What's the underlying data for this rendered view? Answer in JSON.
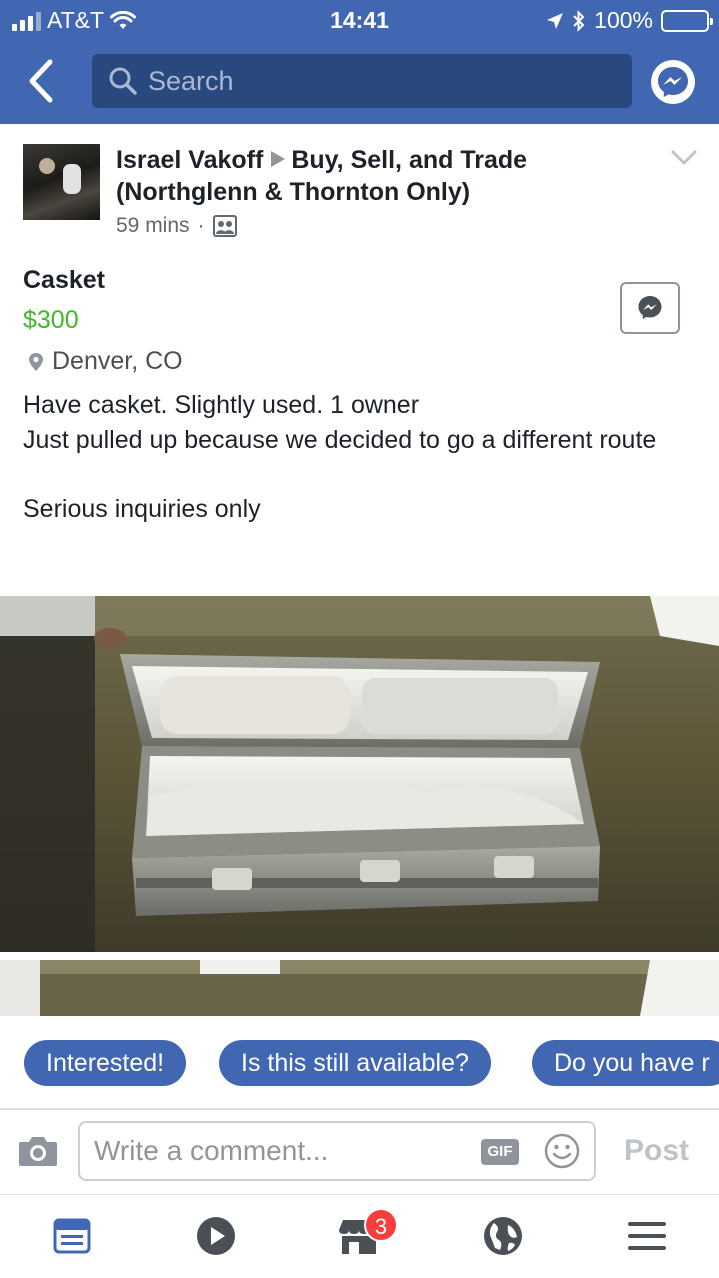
{
  "status_bar": {
    "carrier": "AT&T",
    "time": "14:41",
    "battery": "100%",
    "icons": [
      "signal-icon",
      "wifi-icon",
      "location-arrow-icon",
      "bluetooth-icon",
      "battery-icon"
    ]
  },
  "nav": {
    "search_placeholder": "Search",
    "icons": [
      "back-chevron-icon",
      "search-icon",
      "messenger-icon"
    ]
  },
  "post": {
    "author": "Israel Vakoff",
    "group": "Buy, Sell, and Trade (Northglenn & Thornton Only)",
    "time_ago": "59 mins",
    "separator": "·",
    "icons": [
      "group-audience-icon",
      "chevron-down-icon"
    ]
  },
  "listing": {
    "title": "Casket",
    "price": "$300",
    "location": "Denver, CO",
    "description": [
      "Have casket. Slightly used. 1 owner",
      "Just pulled up because we decided to go a different route",
      "",
      "Serious inquiries only"
    ],
    "icons": [
      "location-pin-icon",
      "messenger-icon"
    ]
  },
  "photos": [
    {
      "alt": "casket photo 1"
    },
    {
      "alt": "casket photo 2"
    }
  ],
  "quick_replies": [
    "Interested!",
    "Is this still available?",
    "Do you have r"
  ],
  "composer": {
    "placeholder": "Write a comment...",
    "gif_label": "GIF",
    "post_label": "Post",
    "icons": [
      "camera-icon",
      "emoji-icon"
    ]
  },
  "tab_bar": {
    "items": [
      "news-feed",
      "watch",
      "marketplace",
      "notifications",
      "menu"
    ],
    "marketplace_badge": "3"
  },
  "colors": {
    "brand_blue": "#4267b2",
    "search_bg": "#29487d",
    "price_green": "#42b72a",
    "badge_red": "#fa3e3e"
  }
}
